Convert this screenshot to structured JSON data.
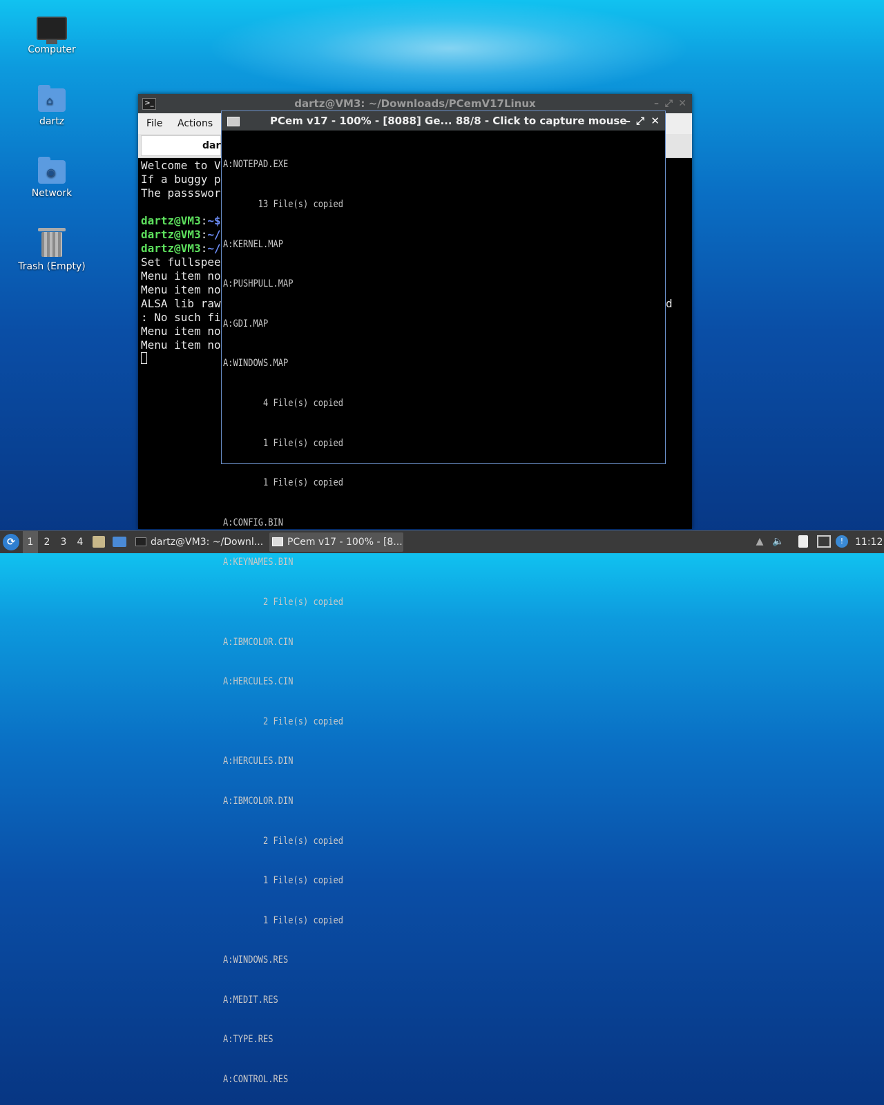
{
  "desktop": {
    "icons": [
      {
        "label": "Computer",
        "icon": "monitor-icon"
      },
      {
        "label": "dartz",
        "icon": "home-folder-icon"
      },
      {
        "label": "Network",
        "icon": "network-folder-icon"
      },
      {
        "label": "Trash (Empty)",
        "icon": "trash-icon"
      }
    ]
  },
  "terminal": {
    "title": "dartz@VM3: ~/Downloads/PCemV17Linux",
    "menu": [
      "File",
      "Actions"
    ],
    "tab_label": "dart",
    "lines": [
      "Welcome to V",
      "If a buggy p",
      "The passswor",
      "",
      {
        "user": "dartz@VM3",
        "sep": ":",
        "path": "~$"
      },
      {
        "user": "dartz@VM3",
        "sep": ":",
        "path": "~/"
      },
      {
        "user": "dartz@VM3",
        "sep": ":",
        "path": "~/"
      },
      "Set fullspee",
      "Menu item no",
      "Menu item no",
      "ALSA lib raw",
      ": No such fi",
      "Menu item no",
      "Menu item no"
    ],
    "line_right_fragment": "d"
  },
  "pcem": {
    "title": "PCem v17 - 100% - [8088] Ge... 88/8 - Click to capture mouse",
    "output": [
      "A:NOTEPAD.EXE",
      "       13 File(s) copied",
      "A:KERNEL.MAP",
      "A:PUSHPULL.MAP",
      "A:GDI.MAP",
      "A:WINDOWS.MAP",
      "        4 File(s) copied",
      "        1 File(s) copied",
      "        1 File(s) copied",
      "A:CONFIG.BIN",
      "A:KEYNAMES.BIN",
      "        2 File(s) copied",
      "A:IBMCOLOR.CIN",
      "A:HERCULES.CIN",
      "        2 File(s) copied",
      "A:HERCULES.DIN",
      "A:IBMCOLOR.DIN",
      "        2 File(s) copied",
      "        1 File(s) copied",
      "        1 File(s) copied",
      "A:WINDOWS.RES",
      "A:MEDIT.RES",
      "A:TYPE.RES",
      "A:CONTROL.RES"
    ]
  },
  "taskbar": {
    "workspaces": [
      "1",
      "2",
      "3",
      "4"
    ],
    "active_workspace": "1",
    "tasks": [
      {
        "label": "dartz@VM3: ~/Downl...",
        "icon": "terminal-icon"
      },
      {
        "label": "PCem v17 - 100% - [8...",
        "icon": "pcem-icon"
      }
    ],
    "clock": "11:12"
  }
}
